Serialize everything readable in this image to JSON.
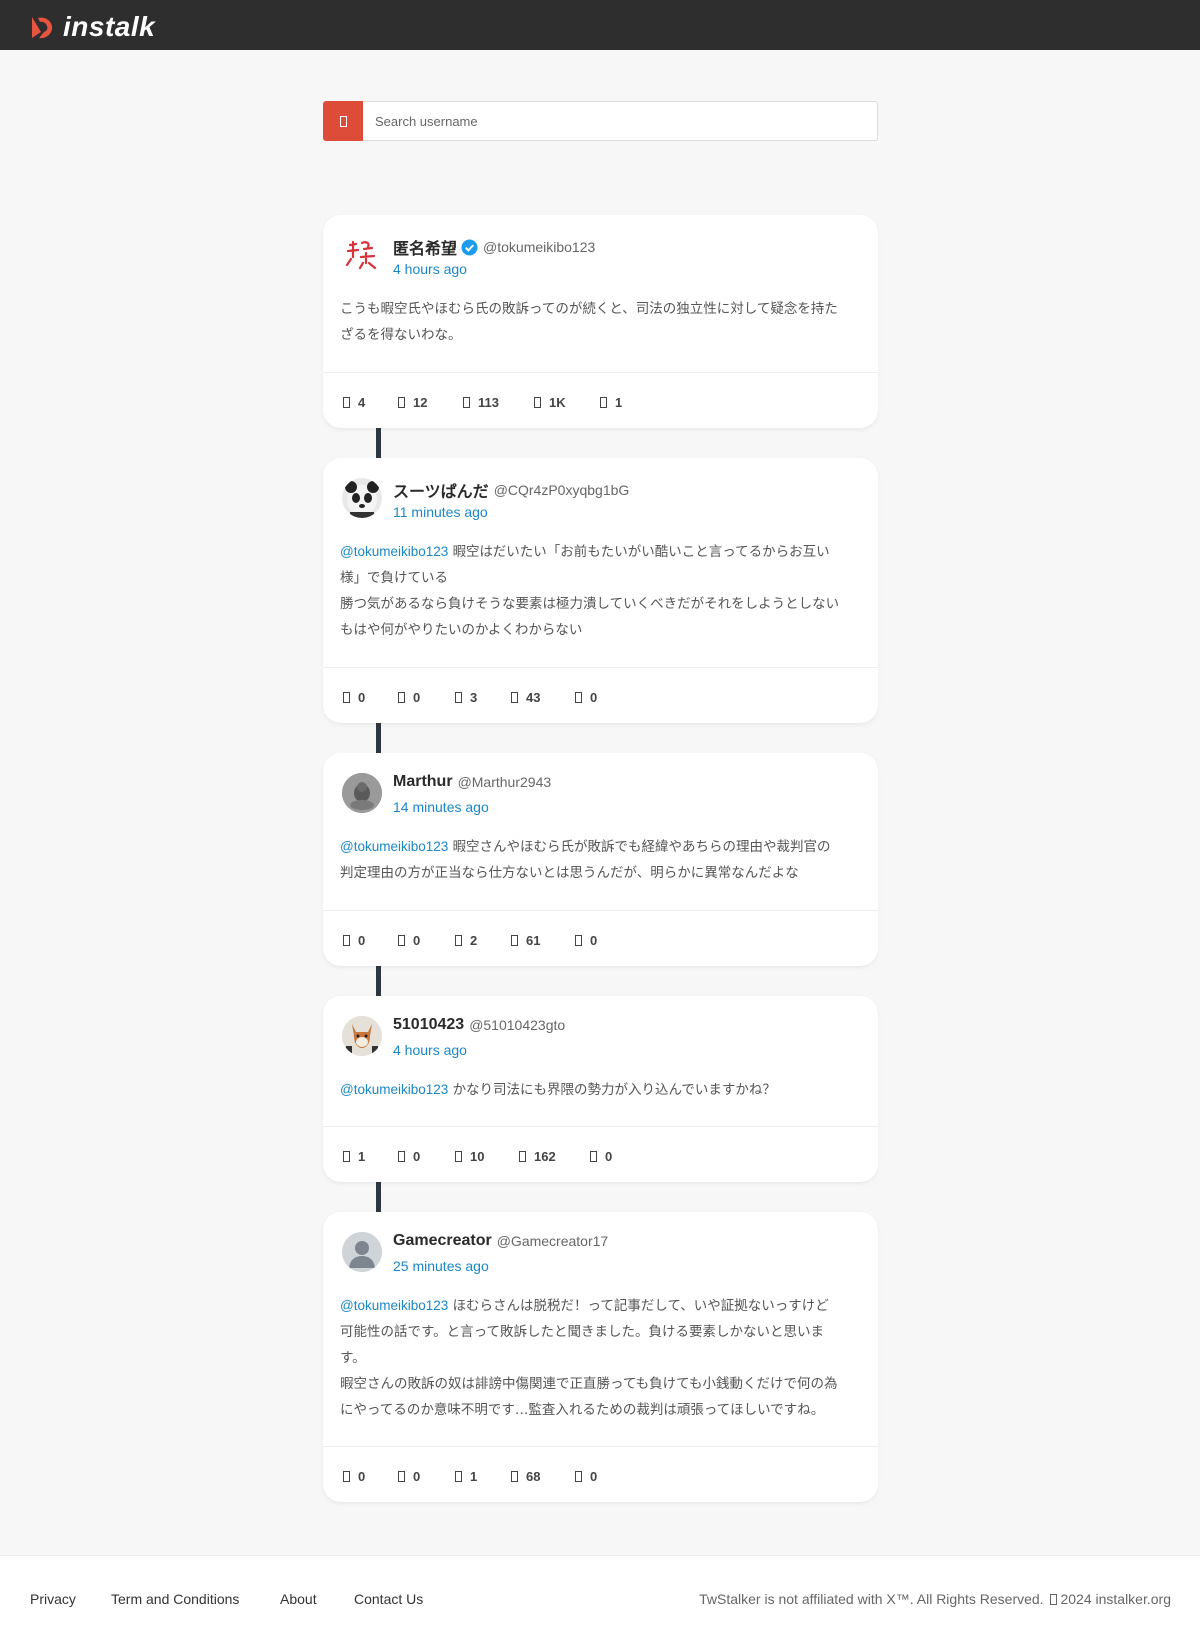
{
  "header": {
    "logo_text": "instalk"
  },
  "search": {
    "placeholder": "Search username"
  },
  "colors": {
    "accent": "#dd4b39",
    "link": "#1b87c7",
    "topbar": "#2e2e2e"
  },
  "posts": [
    {
      "name": "匿名希望",
      "verified": true,
      "handle": "@tokumeikibo123",
      "time": "4 hours ago",
      "mention": "",
      "lines": [
        "こうも暇空氏やほむら氏の敗訴ってのが続くと、司法の独立性に対して疑念を持た",
        "ざるを得ないわな。"
      ],
      "stats": [
        "4",
        "12",
        "113",
        "1K",
        "1"
      ]
    },
    {
      "name": "スーツぱんだ",
      "verified": false,
      "handle": "@CQr4zP0xyqbg1bG",
      "time": "11 minutes ago",
      "mention": "@tokumeikibo123",
      "lines": [
        "暇空はだいたい「お前もたいがい酷いこと言ってるからお互い",
        "様」で負けている",
        "勝つ気があるなら負けそうな要素は極力潰していくべきだがそれをしようとしない",
        "もはや何がやりたいのかよくわからない"
      ],
      "stats": [
        "0",
        "0",
        "3",
        "43",
        "0"
      ]
    },
    {
      "name": "Marthur",
      "verified": false,
      "handle": "@Marthur2943",
      "time": "14 minutes ago",
      "mention": "@tokumeikibo123",
      "lines": [
        "暇空さんやほむら氏が敗訴でも経緯やあちらの理由や裁判官の",
        "判定理由の方が正当なら仕方ないとは思うんだが、明らかに異常なんだよな"
      ],
      "stats": [
        "0",
        "0",
        "2",
        "61",
        "0"
      ]
    },
    {
      "name": "51010423",
      "verified": false,
      "handle": "@51010423gto",
      "time": "4 hours ago",
      "mention": "@tokumeikibo123",
      "lines": [
        "かなり司法にも界隈の勢力が入り込んでいますかね？"
      ],
      "stats": [
        "1",
        "0",
        "10",
        "162",
        "0"
      ]
    },
    {
      "name": "Gamecreator",
      "verified": false,
      "handle": "@Gamecreator17",
      "time": "25 minutes ago",
      "mention": "@tokumeikibo123",
      "lines": [
        "ほむらさんは脱税だ！って記事だして、いや証拠ないっすけど",
        "可能性の話です。と言って敗訴したと聞きました。負ける要素しかないと思いま",
        "す。",
        "暇空さんの敗訴の奴は誹謗中傷関連で正直勝っても負けても小銭動くだけで何の為",
        "にやってるのか意味不明です…監査入れるための裁判は頑張ってほしいですね。"
      ],
      "stats": [
        "0",
        "0",
        "1",
        "68",
        "0"
      ]
    }
  ],
  "footer": {
    "links": [
      "Privacy",
      "Term and Conditions",
      "About",
      "Contact Us"
    ],
    "copyright_pre": "TwStalker is not affiliated with X™. All Rights Reserved.",
    "copyright_post": "2024 instalker.org"
  }
}
